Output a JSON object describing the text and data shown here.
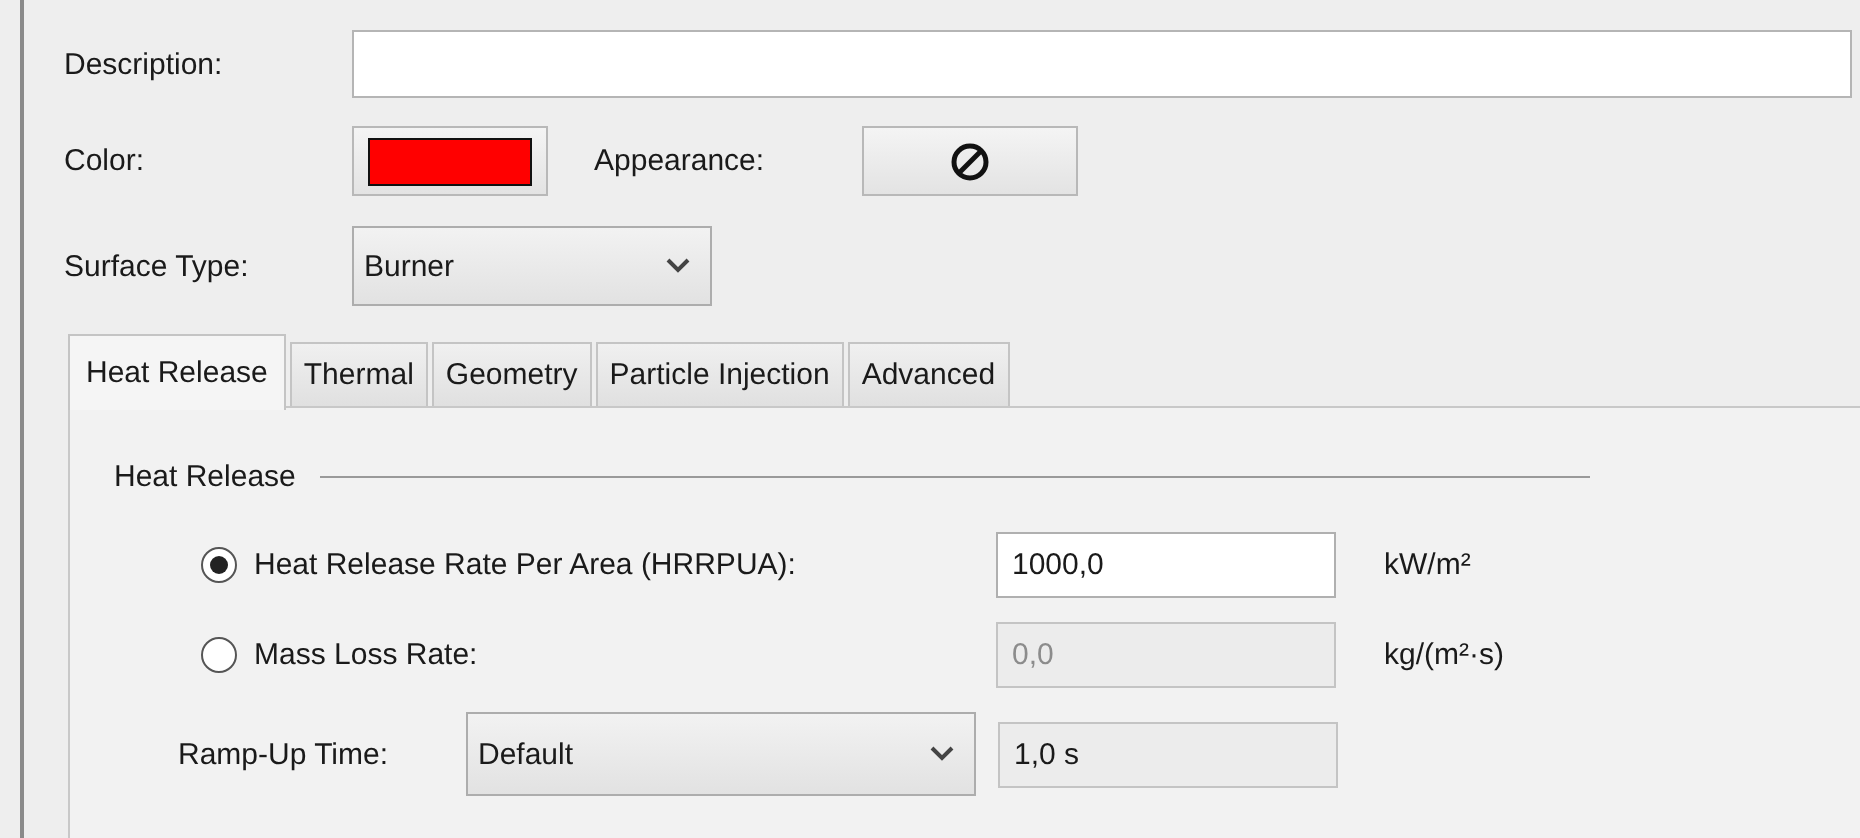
{
  "description": {
    "label": "Description:"
  },
  "color": {
    "label": "Color:",
    "color": "#ff0000"
  },
  "appearance": {
    "label": "Appearance:"
  },
  "surface_type": {
    "label": "Surface Type:",
    "value": "Burner"
  },
  "tabs": [
    {
      "label": "Heat Release",
      "selected": true
    },
    {
      "label": "Thermal",
      "selected": false
    },
    {
      "label": "Geometry",
      "selected": false
    },
    {
      "label": "Particle Injection",
      "selected": false
    },
    {
      "label": "Advanced",
      "selected": false
    }
  ],
  "group": {
    "title": "Heat Release"
  },
  "rows": [
    {
      "kind": "radio",
      "label": "Heat Release Rate Per Area (HRRPUA):",
      "selected": true,
      "value": "1000,0",
      "disabled": false,
      "editable": true,
      "unit": "kW/m²"
    },
    {
      "kind": "radio",
      "label": "Mass Loss Rate:",
      "selected": false,
      "value": "0,0",
      "disabled": true,
      "editable": true,
      "unit": "kg/(m²·s)"
    },
    {
      "kind": "dropdown",
      "label": "Ramp-Up Time:",
      "choice": "Default",
      "value": "1,0 s",
      "disabled": false,
      "editable": false
    }
  ]
}
